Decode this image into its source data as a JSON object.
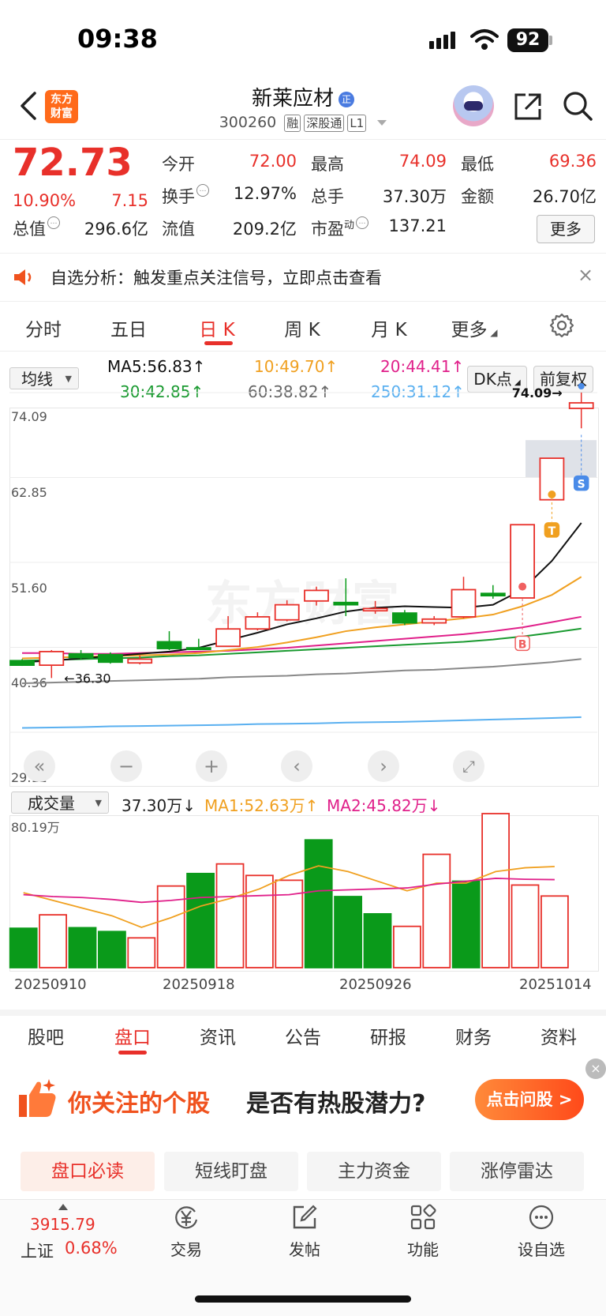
{
  "status": {
    "time": "09:38",
    "battery": "92"
  },
  "header": {
    "app_logo": "东方\n财富",
    "stock_name": "新莱应材",
    "badge": "正",
    "code": "300260",
    "tags": [
      "融",
      "深股通",
      "L1"
    ]
  },
  "quote": {
    "price": "72.73",
    "change_pct": "10.90%",
    "change": "7.15",
    "open_label": "今开",
    "open": "72.00",
    "high_label": "最高",
    "high": "74.09",
    "low_label": "最低",
    "low": "69.36",
    "turnover_label": "换手",
    "turnover": "12.97%",
    "volume_label": "总手",
    "volume": "37.30万",
    "amount_label": "金额",
    "amount": "26.70亿",
    "mktcap_label": "总值",
    "mktcap": "296.6亿",
    "float_label": "流值",
    "float": "209.2亿",
    "pe_label": "市盈",
    "pe_sup": "动",
    "pe": "137.21",
    "more": "更多"
  },
  "notice": {
    "text": "自选分析：触发重点关注信号，立即点击查看",
    "close": "×"
  },
  "chart_tabs": {
    "items": [
      "分时",
      "五日",
      "日 K",
      "周 K",
      "月 K",
      "更多"
    ],
    "active": "日 K"
  },
  "ma": {
    "select": "均线",
    "ma5": "MA5:56.83↑",
    "ma10": "10:49.70↑",
    "ma20": "20:44.41↑",
    "ma30": "30:42.85↑",
    "ma60": "60:38.82↑",
    "ma250": "250:31.12↑",
    "dk_btn": "DK点",
    "adj_btn": "前复权"
  },
  "colors": {
    "up": "#e8302a",
    "down": "#0a9a1a",
    "ma5": "#111111",
    "ma10": "#f0a020",
    "ma20": "#e0208a",
    "ma30": "#1a9a30",
    "ma60": "#888888",
    "ma250": "#5ab0f0"
  },
  "chart_data": [
    {
      "type": "candlestick",
      "y_ticks": [
        "74.09",
        "62.85",
        "51.60",
        "40.36",
        "29.12"
      ],
      "ylim": [
        29.12,
        74.09
      ],
      "watermark": "东方财富",
      "annotations": {
        "high": "74.09→",
        "low": "←36.30",
        "markers": [
          "S",
          "T",
          "B"
        ]
      },
      "candles": [
        {
          "o": 38.6,
          "c": 38.0,
          "h": 38.8,
          "l": 37.9
        },
        {
          "o": 38.0,
          "c": 39.8,
          "h": 40.0,
          "l": 36.3
        },
        {
          "o": 39.5,
          "c": 39.0,
          "h": 40.0,
          "l": 38.7
        },
        {
          "o": 39.4,
          "c": 38.4,
          "h": 39.7,
          "l": 38.2
        },
        {
          "o": 38.3,
          "c": 38.8,
          "h": 39.3,
          "l": 38.1
        },
        {
          "o": 41.1,
          "c": 40.2,
          "h": 42.5,
          "l": 40.0
        },
        {
          "o": 40.3,
          "c": 40.2,
          "h": 41.5,
          "l": 40.0
        },
        {
          "o": 40.5,
          "c": 42.8,
          "h": 44.5,
          "l": 40.5
        },
        {
          "o": 42.8,
          "c": 44.4,
          "h": 45.0,
          "l": 42.6
        },
        {
          "o": 44.0,
          "c": 46.0,
          "h": 46.6,
          "l": 43.8
        },
        {
          "o": 46.5,
          "c": 47.9,
          "h": 48.4,
          "l": 45.9
        },
        {
          "o": 46.3,
          "c": 46.0,
          "h": 49.5,
          "l": 44.5
        },
        {
          "o": 45.2,
          "c": 45.5,
          "h": 46.5,
          "l": 44.8
        },
        {
          "o": 44.9,
          "c": 43.6,
          "h": 45.3,
          "l": 43.3
        },
        {
          "o": 43.6,
          "c": 44.1,
          "h": 44.5,
          "l": 43.3
        },
        {
          "o": 44.4,
          "c": 48.0,
          "h": 49.7,
          "l": 44.2
        },
        {
          "o": 47.5,
          "c": 47.2,
          "h": 48.6,
          "l": 46.8
        },
        {
          "o": 46.9,
          "c": 56.6,
          "h": 56.6,
          "l": 46.9
        },
        {
          "o": 59.9,
          "c": 65.4,
          "h": 65.4,
          "l": 59.9
        },
        {
          "o": 72.0,
          "c": 72.73,
          "h": 74.09,
          "l": 69.36
        }
      ],
      "ma5": [
        38.4,
        38.6,
        38.9,
        39.2,
        39.5,
        39.8,
        40.3,
        41.3,
        42.3,
        43.4,
        44.2,
        45.1,
        45.6,
        45.8,
        45.7,
        45.6,
        46.0,
        48.0,
        51.8,
        56.83
      ],
      "ma10": [
        38.9,
        39.0,
        39.1,
        39.2,
        39.3,
        39.4,
        39.6,
        40.0,
        40.4,
        41.0,
        41.7,
        42.5,
        43.0,
        43.4,
        43.8,
        44.2,
        44.7,
        45.8,
        47.3,
        49.7
      ],
      "ma20": [
        39.6,
        39.6,
        39.5,
        39.5,
        39.6,
        39.7,
        39.8,
        39.9,
        40.1,
        40.3,
        40.6,
        40.9,
        41.2,
        41.5,
        41.8,
        42.1,
        42.5,
        43.0,
        43.7,
        44.41
      ],
      "ma30": [
        38.6,
        38.7,
        38.8,
        38.9,
        39.0,
        39.2,
        39.3,
        39.5,
        39.7,
        39.9,
        40.1,
        40.3,
        40.5,
        40.7,
        40.9,
        41.1,
        41.4,
        41.8,
        42.3,
        42.85
      ],
      "ma60": [
        35.6,
        35.7,
        35.8,
        35.9,
        36.0,
        36.1,
        36.2,
        36.4,
        36.5,
        36.6,
        36.8,
        36.9,
        37.1,
        37.3,
        37.4,
        37.6,
        37.8,
        38.1,
        38.4,
        38.82
      ],
      "ma250": [
        29.7,
        29.75,
        29.8,
        29.9,
        29.95,
        30.0,
        30.05,
        30.1,
        30.2,
        30.25,
        30.3,
        30.4,
        30.45,
        30.5,
        30.6,
        30.7,
        30.8,
        30.9,
        31.0,
        31.12
      ]
    },
    {
      "type": "bar",
      "select": "成交量",
      "current": "37.30万↓",
      "ma1_label": "MA1:52.63万↑",
      "ma2_label": "MA2:45.82万↓",
      "ymax_label": "80.19万",
      "ymax": 80.19,
      "dates": [
        "20250910",
        "20250918",
        "20250926",
        "20251014"
      ],
      "values": [
        20.5,
        27.5,
        20.8,
        18.8,
        15.5,
        42.5,
        49.0,
        54.0,
        48.0,
        45.5,
        66.5,
        37.0,
        28.0,
        21.5,
        59.0,
        45.0,
        80.19,
        43.0,
        37.3
      ],
      "ma1": [
        39.0,
        35.0,
        31.0,
        27.0,
        21.0,
        26.0,
        32.0,
        36.0,
        41.0,
        48.0,
        53.0,
        50.0,
        45.0,
        40.0,
        44.0,
        44.0,
        50.0,
        52.0,
        52.63
      ],
      "ma2": [
        38.0,
        37.0,
        36.5,
        35.5,
        34.0,
        35.0,
        36.5,
        37.0,
        37.5,
        38.0,
        40.0,
        40.5,
        41.0,
        41.5,
        43.5,
        45.0,
        46.5,
        46.0,
        45.82
      ]
    }
  ],
  "bottom_tabs": {
    "items": [
      "股吧",
      "盘口",
      "资讯",
      "公告",
      "研报",
      "财务",
      "资料"
    ],
    "active": "盘口"
  },
  "banner": {
    "text1": "你关注的个股",
    "text2": "是否有热股潜力?",
    "button": "点击问股 >",
    "close": "×"
  },
  "sub_tabs": {
    "items": [
      "盘口必读",
      "短线盯盘",
      "主力资金",
      "涨停雷达"
    ],
    "active": "盘口必读"
  },
  "bottom_bar": {
    "index_value": "3915.79",
    "index_name": "上证",
    "index_pct": "0.68%",
    "nav": [
      "交易",
      "发帖",
      "功能",
      "设自选"
    ]
  }
}
